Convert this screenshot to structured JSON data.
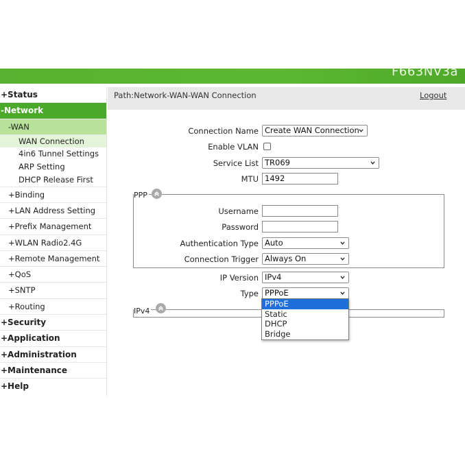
{
  "header": {
    "model": "F663NV3a"
  },
  "sidebar": {
    "items": [
      {
        "label": "+Status"
      },
      {
        "label": "-Network"
      },
      {
        "label": "-WAN"
      },
      {
        "label": "WAN Connection"
      },
      {
        "label": "4in6 Tunnel Settings"
      },
      {
        "label": "ARP Setting"
      },
      {
        "label": "DHCP Release First"
      },
      {
        "label": "+Binding"
      },
      {
        "label": "+LAN Address Setting"
      },
      {
        "label": "+Prefix Management"
      },
      {
        "label": "+WLAN Radio2.4G"
      },
      {
        "label": "+Remote Management"
      },
      {
        "label": "+QoS"
      },
      {
        "label": "+SNTP"
      },
      {
        "label": "+Routing"
      },
      {
        "label": "+Security"
      },
      {
        "label": "+Application"
      },
      {
        "label": "+Administration"
      },
      {
        "label": "+Maintenance"
      },
      {
        "label": "+Help"
      }
    ]
  },
  "pathbar": {
    "path": "Path:Network-WAN-WAN Connection",
    "logout": "Logout"
  },
  "form": {
    "connection_name": {
      "label": "Connection Name",
      "value": "Create WAN Connection"
    },
    "enable_vlan": {
      "label": "Enable VLAN",
      "checked": false
    },
    "service_list": {
      "label": "Service List",
      "value": "TR069"
    },
    "mtu": {
      "label": "MTU",
      "value": "1492"
    },
    "ppp": {
      "legend": "PPP",
      "username": {
        "label": "Username",
        "value": ""
      },
      "password": {
        "label": "Password",
        "value": ""
      },
      "auth_type": {
        "label": "Authentication Type",
        "value": "Auto"
      },
      "conn_trigger": {
        "label": "Connection Trigger",
        "value": "Always On"
      }
    },
    "ip_version": {
      "label": "IP Version",
      "value": "IPv4"
    },
    "type": {
      "label": "Type",
      "value": "PPPoE",
      "options": [
        "PPPoE",
        "Static",
        "DHCP",
        "Bridge"
      ]
    },
    "ipv4": {
      "legend": "IPv4"
    }
  },
  "colors": {
    "accent": "#4aa82a",
    "sub_active": "#b8e29a",
    "leaf_active": "#e4f4d8",
    "selection": "#1e6fd9"
  },
  "icons": {
    "collapse": "chevron-up-circle-icon",
    "select_arrow": "chevron-down-icon"
  }
}
